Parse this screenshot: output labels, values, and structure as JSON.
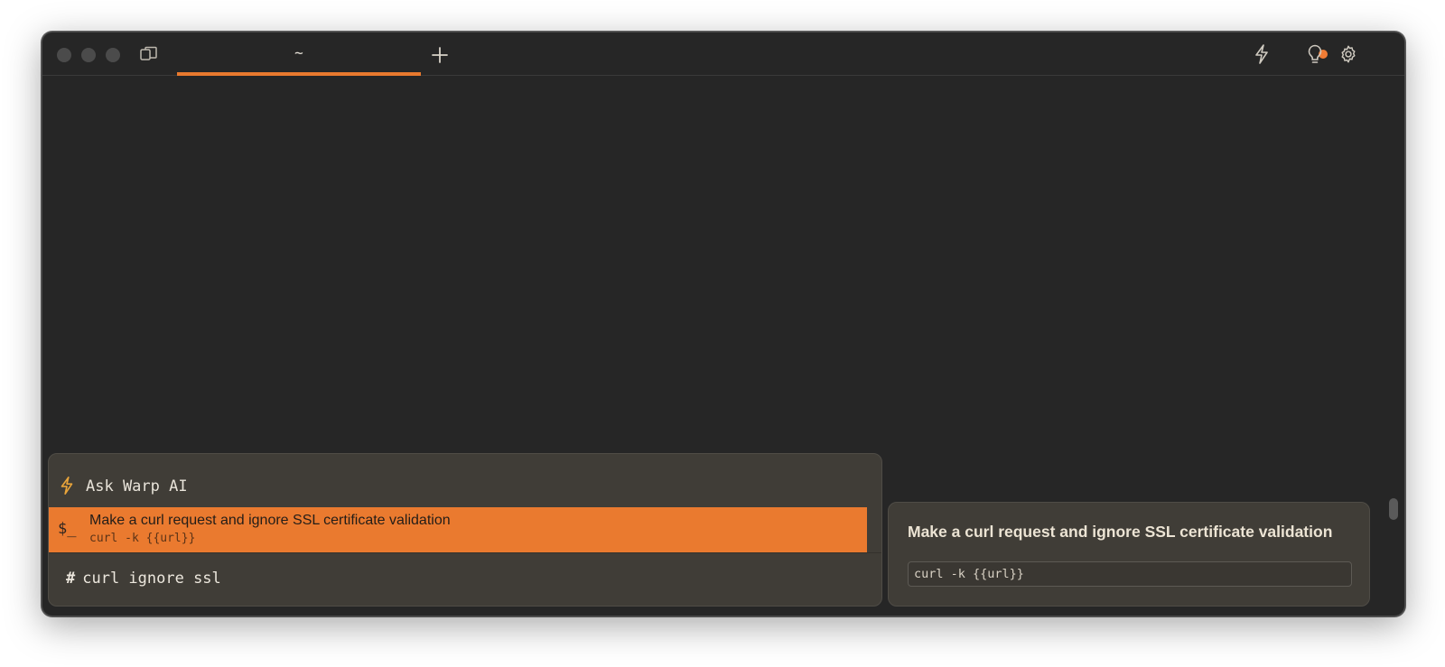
{
  "window": {
    "tabs": [
      {
        "label": "~",
        "active": true
      }
    ],
    "accent_color": "#e8792e",
    "notification_dot_color": "#f07c35",
    "titlebar_icons": [
      "panes-icon",
      "add-tab-icon",
      "bolt-icon",
      "lightbulb-icon",
      "gear-icon"
    ]
  },
  "palette": {
    "ask_ai_label": "Ask Warp AI",
    "results": [
      {
        "prompt_symbol": "$_",
        "title": "Make a curl request and ignore SSL certificate validation",
        "command": "curl -k {{url}}",
        "selected": true
      }
    ],
    "input": {
      "prefix": "#",
      "value": "curl ignore ssl"
    }
  },
  "detail": {
    "title": "Make a curl request and ignore SSL certificate validation",
    "command": "curl -k {{url}}"
  }
}
